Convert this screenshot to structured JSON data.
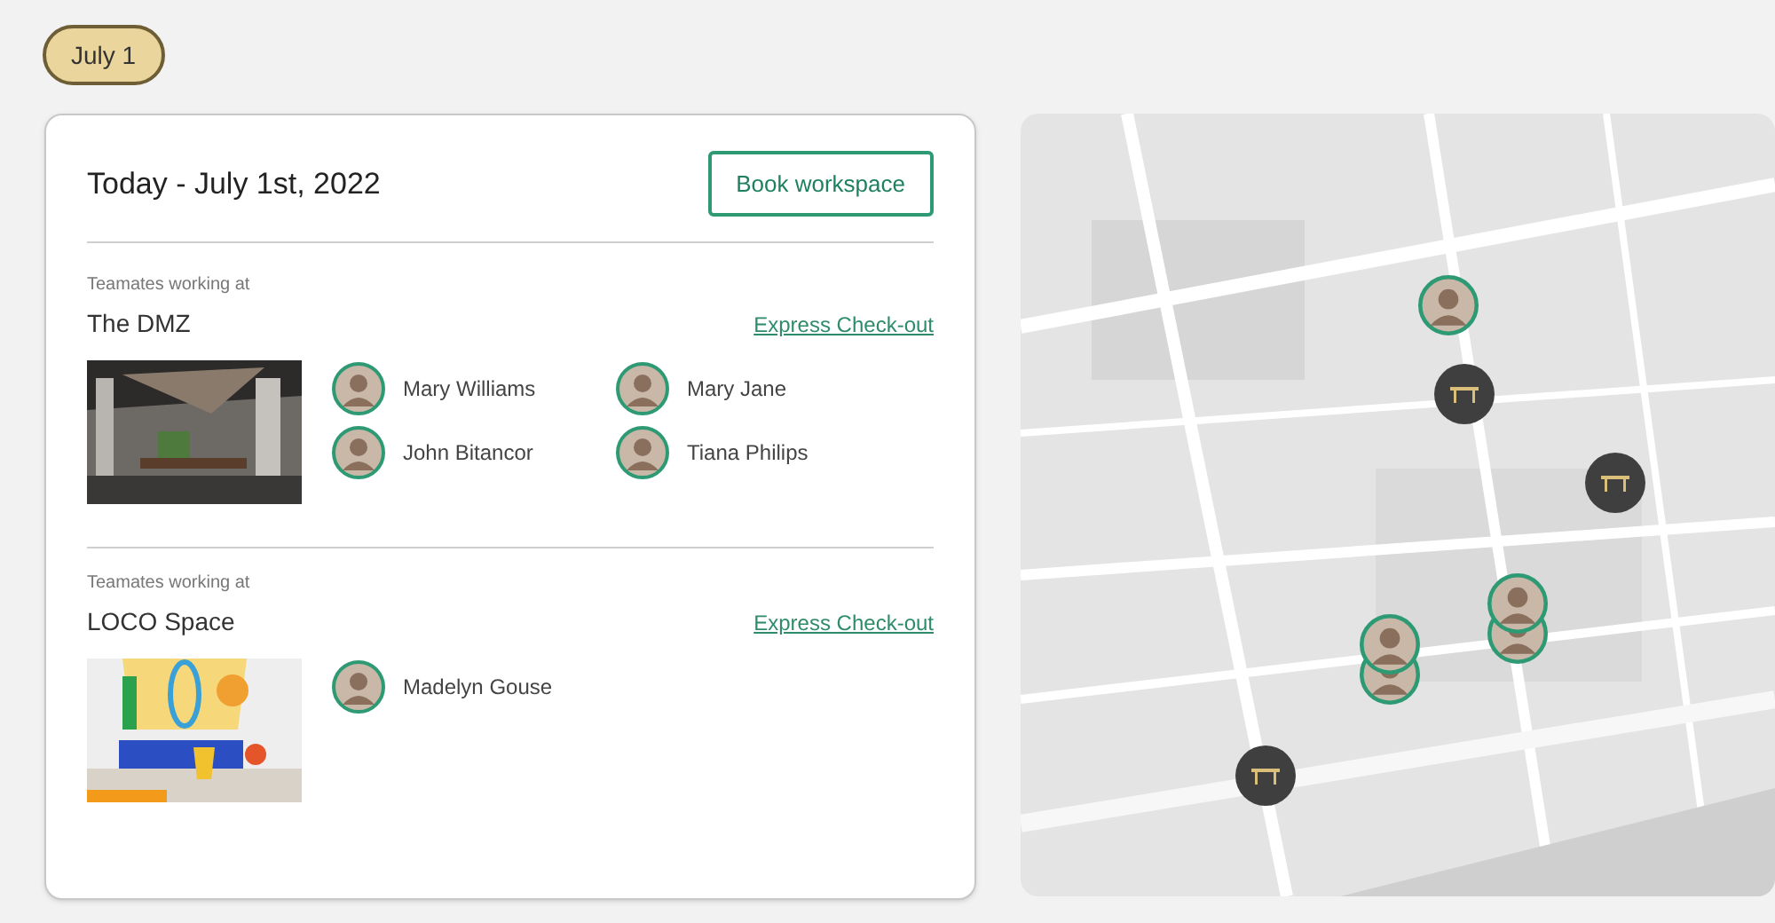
{
  "date_chip": "July 1",
  "card": {
    "title": "Today - July 1st, 2022",
    "book_button": "Book workspace",
    "sections": [
      {
        "caption": "Teamates working at",
        "place": "The DMZ",
        "checkout_link": "Express Check-out",
        "photo": {
          "kind": "picture"
        },
        "teammates": [
          "Mary Williams",
          "Mary Jane",
          "John Bitancor",
          "Tiana Philips"
        ]
      },
      {
        "caption": "Teamates working at",
        "place": "LOCO Space",
        "checkout_link": "Express Check-out",
        "photo": {
          "kind": "picture"
        },
        "teammates": [
          "Madelyn Gouse"
        ]
      }
    ]
  },
  "map": {
    "pins": [
      {
        "kind": "person"
      },
      {
        "kind": "desk"
      },
      {
        "kind": "desk"
      },
      {
        "kind": "desk"
      },
      {
        "kind": "person"
      },
      {
        "kind": "person"
      },
      {
        "kind": "person"
      },
      {
        "kind": "person"
      }
    ]
  }
}
